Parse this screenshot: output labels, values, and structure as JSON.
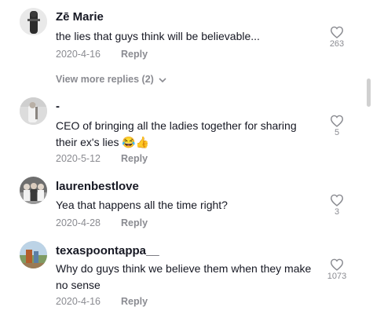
{
  "comments": [
    {
      "username": "Zē Marie",
      "text": "the lies that guys think will be believable...",
      "date": "2020-4-16",
      "reply_label": "Reply",
      "likes": "263",
      "avatar": "avatar-photo-dark"
    },
    {
      "username": "-",
      "text": "CEO of bringing all the ladies together for sharing their ex's lies 😂👍",
      "date": "2020-5-12",
      "reply_label": "Reply",
      "likes": "5",
      "avatar": "avatar-photo-light"
    },
    {
      "username": "laurenbestlove",
      "text": "Yea that happens all the time right?",
      "date": "2020-4-28",
      "reply_label": "Reply",
      "likes": "3",
      "avatar": "avatar-photo-group"
    },
    {
      "username": "texaspoontappa__",
      "text": "Why do guys think we believe them when they make no sense",
      "date": "2020-4-16",
      "reply_label": "Reply",
      "likes": "1073",
      "avatar": "avatar-photo-outdoor"
    }
  ],
  "view_more_replies": "View more replies (2)",
  "icons": {
    "like": "heart-outline-icon",
    "expand": "chevron-down-icon"
  },
  "colors": {
    "text": "#161823",
    "muted": "#8a8b91",
    "scrollbar": "#d0d0d0"
  }
}
